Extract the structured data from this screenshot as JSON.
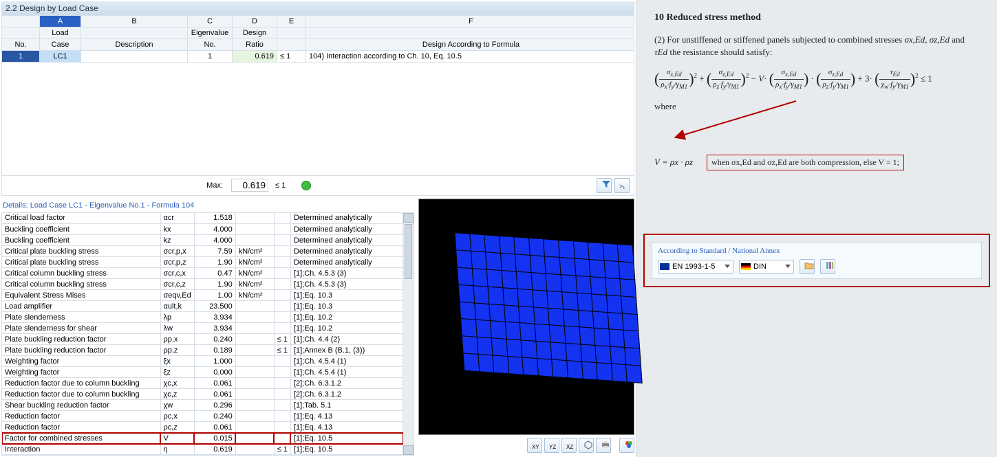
{
  "panel": {
    "title": "2.2 Design by Load Case"
  },
  "columns": {
    "letters": [
      "",
      "A",
      "B",
      "C",
      "D",
      "E",
      "F"
    ],
    "headers_top": [
      "",
      "Load",
      "",
      "Eigenvalue",
      "Design",
      "",
      ""
    ],
    "headers_bot": [
      "No.",
      "Case",
      "Description",
      "No.",
      "Ratio",
      "",
      "Design According to Formula"
    ]
  },
  "row": {
    "no": "1",
    "case": "LC1",
    "desc": "",
    "eig": "1",
    "ratio": "0.619",
    "le": "≤ 1",
    "formula": "104) Interaction according to Ch. 10, Eq. 10.5"
  },
  "max": {
    "label": "Max:",
    "value": "0.619",
    "le": "≤ 1"
  },
  "details_title": "Details:  Load Case LC1 - Eigenvalue No.1 - Formula 104",
  "details": [
    {
      "label": "Critical load factor",
      "sym": "αcr",
      "val": "1.518",
      "unit": "",
      "le": "",
      "note": "Determined analytically"
    },
    {
      "label": "Buckling coefficient",
      "sym": "kx",
      "val": "4.000",
      "unit": "",
      "le": "",
      "note": "Determined analytically"
    },
    {
      "label": "Buckling coefficient",
      "sym": "kz",
      "val": "4.000",
      "unit": "",
      "le": "",
      "note": "Determined analytically"
    },
    {
      "label": "Critical plate buckling stress",
      "sym": "σcr,p,x",
      "val": "7.59",
      "unit": "kN/cm²",
      "le": "",
      "note": "Determined analytically"
    },
    {
      "label": "Critical plate buckling stress",
      "sym": "σcr,p,z",
      "val": "1.90",
      "unit": "kN/cm²",
      "le": "",
      "note": "Determined analytically"
    },
    {
      "label": "Critical column buckling stress",
      "sym": "σcr,c,x",
      "val": "0.47",
      "unit": "kN/cm²",
      "le": "",
      "note": "[1];Ch. 4.5.3 (3)"
    },
    {
      "label": "Critical column buckling stress",
      "sym": "σcr,c,z",
      "val": "1.90",
      "unit": "kN/cm²",
      "le": "",
      "note": "[1];Ch. 4.5.3 (3)"
    },
    {
      "label": "Equivalent Stress Mises",
      "sym": "σeqv,Ed",
      "val": "1.00",
      "unit": "kN/cm²",
      "le": "",
      "note": "[1];Eq. 10.3"
    },
    {
      "label": "Load amplifier",
      "sym": "αult,k",
      "val": "23.500",
      "unit": "",
      "le": "",
      "note": "[1];Eq. 10.3"
    },
    {
      "label": "Plate slenderness",
      "sym": "λp",
      "val": "3.934",
      "unit": "",
      "le": "",
      "note": "[1];Eq. 10.2"
    },
    {
      "label": "Plate slenderness for shear",
      "sym": "λw",
      "val": "3.934",
      "unit": "",
      "le": "",
      "note": "[1];Eq. 10.2"
    },
    {
      "label": "Plate buckling reduction factor",
      "sym": "ρp,x",
      "val": "0.240",
      "unit": "",
      "le": "≤ 1",
      "note": "[1];Ch. 4.4 (2)"
    },
    {
      "label": "Plate buckling reduction factor",
      "sym": "ρp,z",
      "val": "0.189",
      "unit": "",
      "le": "≤ 1",
      "note": "[1];Annex B (B.1, (3))"
    },
    {
      "label": "Weighting factor",
      "sym": "ξx",
      "val": "1.000",
      "unit": "",
      "le": "",
      "note": "[1];Ch. 4.5.4 (1)"
    },
    {
      "label": "Weighting factor",
      "sym": "ξz",
      "val": "0.000",
      "unit": "",
      "le": "",
      "note": "[1];Ch. 4.5.4 (1)"
    },
    {
      "label": "Reduction factor due to column buckling",
      "sym": "χc,x",
      "val": "0.061",
      "unit": "",
      "le": "",
      "note": "[2];Ch. 6.3.1.2"
    },
    {
      "label": "Reduction factor due to column buckling",
      "sym": "χc,z",
      "val": "0.061",
      "unit": "",
      "le": "",
      "note": "[2];Ch. 6.3.1.2"
    },
    {
      "label": "Shear buckling reduction factor",
      "sym": "χw",
      "val": "0.296",
      "unit": "",
      "le": "",
      "note": "[1];Tab. 5.1"
    },
    {
      "label": "Reduction factor",
      "sym": "ρc,x",
      "val": "0.240",
      "unit": "",
      "le": "",
      "note": "[1];Eq. 4.13"
    },
    {
      "label": "Reduction factor",
      "sym": "ρc,z",
      "val": "0.061",
      "unit": "",
      "le": "",
      "note": "[1];Eq. 4.13"
    },
    {
      "label": "Factor for combined stresses",
      "sym": "V",
      "val": "0.015",
      "unit": "",
      "le": "",
      "note": "[1];Eq. 10.5",
      "hl": true
    },
    {
      "label": "Interaction",
      "sym": "η",
      "val": "0.619",
      "unit": "",
      "le": "≤ 1",
      "note": "[1];Eq. 10.5"
    }
  ],
  "doc": {
    "h": "10   Reduced stress method",
    "p1a": "(2)   For unstiffened or stiffened panels subjected to combined stresses ",
    "p1b": " and ",
    "p1c": " the resistance should satisfy:",
    "sx": "σx,Ed",
    "sz": "σz,Ed",
    "tau": "τEd",
    "where": "where",
    "veq": "V = ρx · ρz",
    "vnote": "when σx,Ed and σz,Ed are both compression, else V = 1;",
    "le": "≤ 1"
  },
  "annex": {
    "title": "According to Standard / National Annex",
    "std": "EN 1993-1-5",
    "na": "DIN"
  }
}
